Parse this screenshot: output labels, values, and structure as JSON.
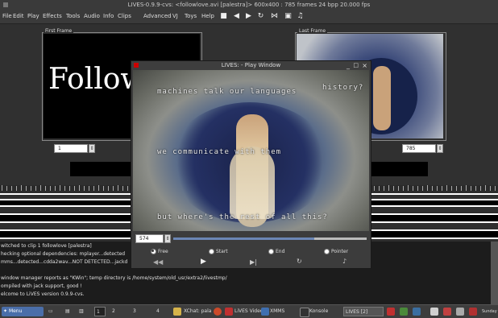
{
  "main_window": {
    "title": "LIVES-0.9.9-cvs: <followlove.avi [palestra]> 600x400 : 785 frames 24 bpp 20.000 fps"
  },
  "menubar": {
    "items": [
      "File",
      "Edit",
      "Play",
      "Effects",
      "Tools",
      "Audio",
      "Info",
      "Clips",
      "Advanced",
      "VJ",
      "Toys",
      "Help"
    ]
  },
  "first_frame": {
    "label": "First Frame",
    "preview_text": "Follow",
    "spinner_value": "1"
  },
  "last_frame": {
    "label": "Last Frame",
    "spinner_value": "785"
  },
  "play_window": {
    "title": "LIVES: - Play Window",
    "overlay_texts": [
      "machines talk our languages",
      "history?",
      "we communicate with them",
      "but where's the rest of all this?"
    ],
    "frame_value": "574",
    "radio_options": [
      "Free",
      "Start",
      "End",
      "Pointer"
    ],
    "selected_radio": "Free",
    "position_fraction": 0.73
  },
  "console": {
    "lines": [
      "witched to clip 1 followlove [palestra]",
      "hecking optional dependencies: mplayer...detected",
      "mms...detected...cdda2wav...NOT DETECTED...jackd",
      "",
      "window manager reports as \"KWin\"; temp directory is /home/system/old_usr/extra2/livestmp/",
      "ompiled with jack support, good !",
      "elcome to LiVES version 0.9.9-cvs."
    ]
  },
  "taskbar": {
    "menu_label": "Menu",
    "workspaces": [
      "1",
      "2",
      "3",
      "4"
    ],
    "tasks": [
      "XChat: pala",
      "LiVES Video",
      "XMMS",
      "Konsole",
      "LIVES [2]"
    ],
    "clock": "Sunday"
  }
}
